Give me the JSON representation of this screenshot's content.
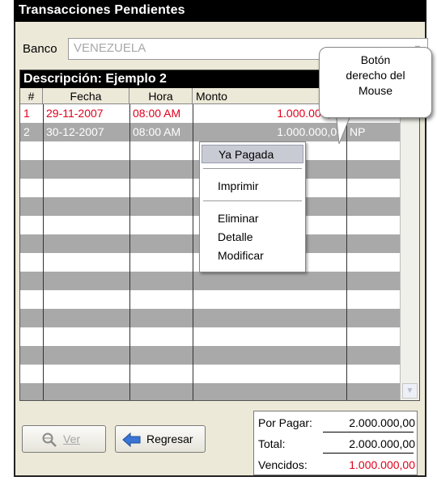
{
  "window": {
    "title": "Transacciones Pendientes"
  },
  "banco": {
    "label": "Banco",
    "value": "VENEZUELA"
  },
  "grid": {
    "caption": "Descripción: Ejemplo 2",
    "columns": [
      "#",
      "Fecha",
      "Hora",
      "Monto"
    ],
    "rows": [
      {
        "num": "1",
        "fecha": "29-11-2007",
        "hora": "08:00 AM",
        "monto": "1.000.000,00",
        "extra": ""
      },
      {
        "num": "2",
        "fecha": "30-12-2007",
        "hora": "08:00 AM",
        "monto": "1.000.000,00",
        "extra": "NP"
      }
    ]
  },
  "context_menu": {
    "items": [
      "Ya Pagada",
      "Imprimir",
      "Eliminar",
      "Detalle",
      "Modificar"
    ]
  },
  "callout": {
    "lines": [
      "Botón",
      "derecho del",
      "Mouse"
    ]
  },
  "buttons": {
    "ver": "Ver",
    "regresar": "Regresar"
  },
  "totals": {
    "por_pagar_label": "Por Pagar:",
    "por_pagar_value": "2.000.000,00",
    "total_label": "Total:",
    "total_value": "2.000.000,00",
    "vencidos_label": "Vencidos:",
    "vencidos_value": "1.000.000,00"
  },
  "colors": {
    "overdue": "#e0001c",
    "selected_text": "#ffffff",
    "row_dark": "#a9a9a9"
  },
  "icons": {
    "ver": "magnifier-icon",
    "regresar": "back-arrow-icon",
    "select": "chevron-down-icon"
  }
}
